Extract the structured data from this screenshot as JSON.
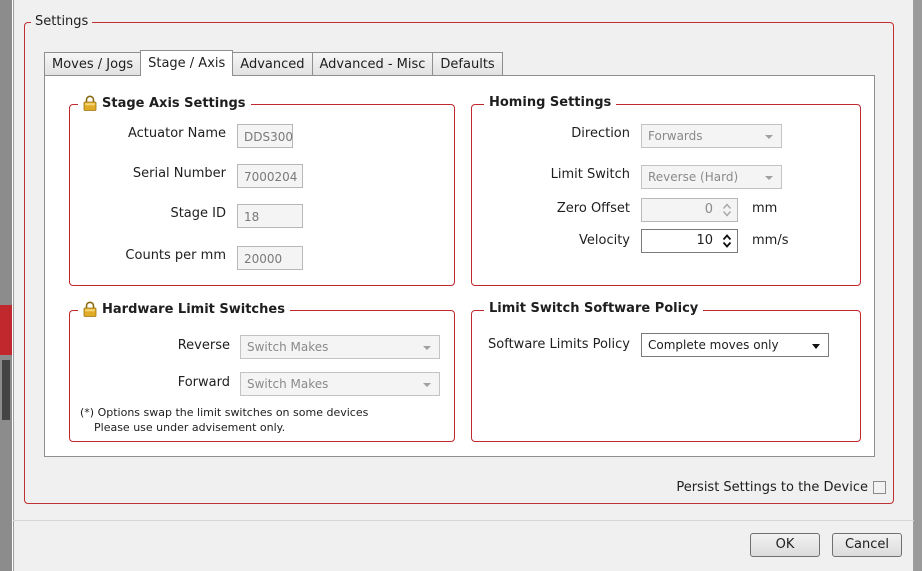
{
  "settings_title": "Settings",
  "tabs": [
    "Moves / Jogs",
    "Stage / Axis",
    "Advanced",
    "Advanced - Misc",
    "Defaults"
  ],
  "active_tab": "Stage / Axis",
  "stage_axis": {
    "title": "Stage Axis Settings",
    "actuator_name_label": "Actuator Name",
    "actuator_name_value": "DDS300",
    "serial_number_label": "Serial Number",
    "serial_number_value": "7000204",
    "stage_id_label": "Stage ID",
    "stage_id_value": "18",
    "counts_label": "Counts per mm",
    "counts_value": "20000"
  },
  "homing": {
    "title": "Homing Settings",
    "direction_label": "Direction",
    "direction_value": "Forwards",
    "limit_switch_label": "Limit Switch",
    "limit_switch_value": "Reverse (Hard)",
    "zero_offset_label": "Zero Offset",
    "zero_offset_value": "0",
    "zero_offset_unit": "mm",
    "velocity_label": "Velocity",
    "velocity_value": "10",
    "velocity_unit": "mm/s"
  },
  "hw_limits": {
    "title": "Hardware Limit Switches",
    "reverse_label": "Reverse",
    "reverse_value": "Switch Makes",
    "forward_label": "Forward",
    "forward_value": "Switch Makes",
    "note_line1": "(*) Options swap the limit switches on some devices",
    "note_line2": "Please use under advisement only."
  },
  "sw_policy": {
    "title": "Limit Switch Software Policy",
    "policy_label": "Software Limits Policy",
    "policy_value": "Complete moves only"
  },
  "persist_label": "Persist Settings to the Device",
  "persist_checked": false,
  "ok_label": "OK",
  "cancel_label": "Cancel",
  "icons": {
    "lock": "lock-icon",
    "combo_arrow": "chevron-down-icon",
    "spin": "spin-arrows-icon"
  },
  "colors": {
    "group_border": "#c0282d",
    "lock_gold": "#d9a520"
  }
}
